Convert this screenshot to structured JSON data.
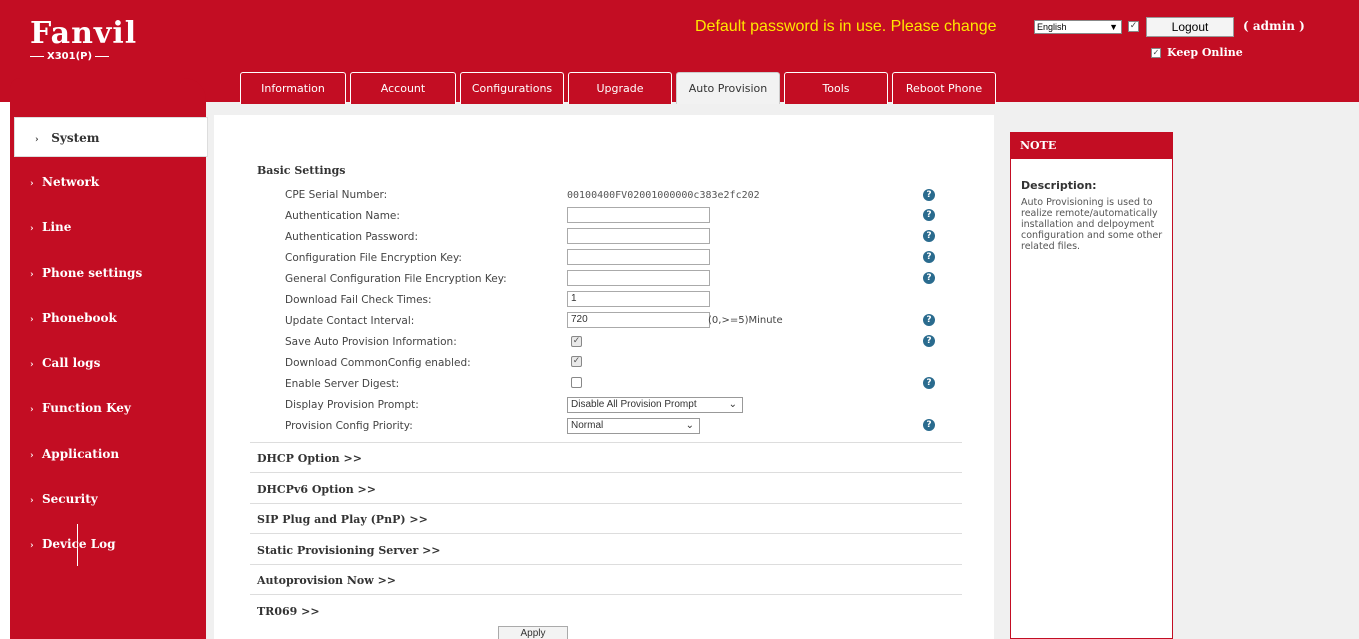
{
  "header": {
    "brand": "Fanvil",
    "model": "X301(P)",
    "warning": "Default password is in use. Please change",
    "language": "English",
    "logout_label": "Logout",
    "user": "( admin )",
    "keep_online_label": "Keep Online",
    "keep_online_checked": true
  },
  "tabs": [
    {
      "label": "Information"
    },
    {
      "label": "Account"
    },
    {
      "label": "Configurations"
    },
    {
      "label": "Upgrade"
    },
    {
      "label": "Auto Provision"
    },
    {
      "label": "Tools"
    },
    {
      "label": "Reboot Phone"
    }
  ],
  "active_tab": "Auto Provision",
  "sidebar": {
    "items": [
      {
        "label": "System"
      },
      {
        "label": "Network"
      },
      {
        "label": "Line"
      },
      {
        "label": "Phone settings"
      },
      {
        "label": "Phonebook"
      },
      {
        "label": "Call logs"
      },
      {
        "label": "Function Key"
      },
      {
        "label": "Application"
      },
      {
        "label": "Security"
      },
      {
        "label": "Device Log"
      }
    ],
    "active": "System"
  },
  "basic_settings": {
    "title": "Basic Settings",
    "cpe_serial_label": "CPE Serial Number:",
    "cpe_serial_value": "00100400FV02001000000c383e2fc202",
    "auth_name_label": "Authentication Name:",
    "auth_name_value": "",
    "auth_password_label": "Authentication Password:",
    "auth_password_value": "",
    "config_key_label": "Configuration File Encryption Key:",
    "config_key_value": "",
    "general_key_label": "General Configuration File Encryption Key:",
    "general_key_value": "",
    "fail_check_label": "Download Fail Check Times:",
    "fail_check_value": "1",
    "update_interval_label": "Update Contact Interval:",
    "update_interval_value": "720",
    "update_interval_unit": "(0,>=5)Minute",
    "save_info_label": "Save Auto Provision Information:",
    "save_info_checked": true,
    "common_config_label": "Download CommonConfig enabled:",
    "common_config_checked": true,
    "server_digest_label": "Enable Server Digest:",
    "server_digest_checked": false,
    "prompt_label": "Display Provision Prompt:",
    "prompt_value": "Disable All Provision Prompt",
    "priority_label": "Provision Config Priority:",
    "priority_value": "Normal"
  },
  "sections": [
    {
      "label": "DHCP Option >>"
    },
    {
      "label": "DHCPv6 Option >>"
    },
    {
      "label": "SIP Plug and Play (PnP) >>"
    },
    {
      "label": "Static Provisioning Server >>"
    },
    {
      "label": "Autoprovision Now >>"
    },
    {
      "label": "TR069 >>"
    }
  ],
  "apply_label": "Apply",
  "note": {
    "header": "NOTE",
    "title": "Description:",
    "body": "Auto Provisioning is used to realize remote/automatically installation and delpoyment configuration and some other related files."
  },
  "help_icon_glyph": "?",
  "colors": {
    "brand_red": "#c30d23",
    "warning_yellow": "#ffe600",
    "help_blue": "#2a6b8e"
  }
}
